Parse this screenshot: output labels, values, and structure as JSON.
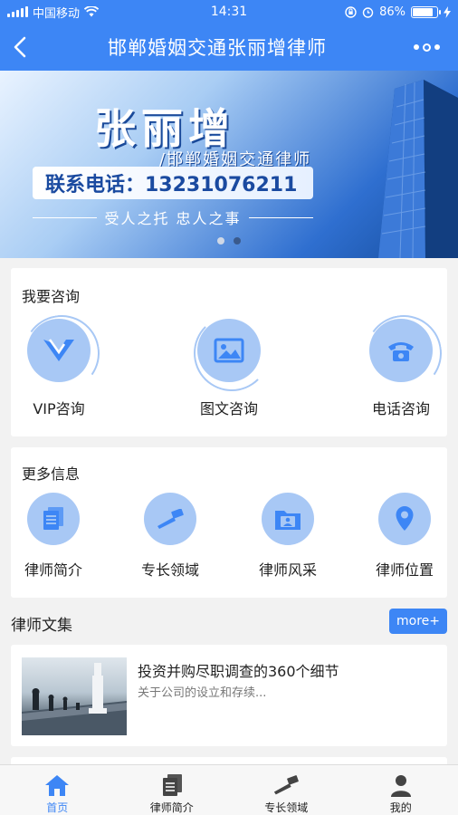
{
  "status_bar": {
    "carrier": "中国移动",
    "time": "14:31",
    "battery": "86%",
    "battery_level": 0.86
  },
  "nav": {
    "title": "邯郸婚姻交通张丽增律师"
  },
  "banner": {
    "name": "张丽增",
    "subtitle": "/邯郸婚姻交通律师",
    "phone": "联系电话：13231076211",
    "slogan": "受人之托 忠人之事",
    "slide_count": 2,
    "active_slide": 1
  },
  "consult": {
    "title": "我要咨询",
    "items": [
      {
        "label": "VIP咨询",
        "icon": "vip-icon"
      },
      {
        "label": "图文咨询",
        "icon": "image-icon"
      },
      {
        "label": "电话咨询",
        "icon": "phone-icon"
      }
    ]
  },
  "more_info": {
    "title": "更多信息",
    "items": [
      {
        "label": "律师简介",
        "icon": "document-icon"
      },
      {
        "label": "专长领域",
        "icon": "gavel-icon"
      },
      {
        "label": "律师风采",
        "icon": "folder-photo-icon"
      },
      {
        "label": "律师位置",
        "icon": "location-icon"
      }
    ]
  },
  "articles": {
    "title": "律师文集",
    "more_label": "more+",
    "items": [
      {
        "title": "投资并购尽职调查的360个细节",
        "desc": "关于公司的设立和存续..."
      }
    ]
  },
  "tabbar": {
    "active": 0,
    "items": [
      {
        "label": "首页",
        "icon": "home-icon"
      },
      {
        "label": "律师简介",
        "icon": "document-icon"
      },
      {
        "label": "专长领域",
        "icon": "gavel-icon"
      },
      {
        "label": "我的",
        "icon": "user-icon"
      }
    ]
  },
  "colors": {
    "primary": "#3d86f5",
    "icon_circle": "#a8c8f5"
  }
}
